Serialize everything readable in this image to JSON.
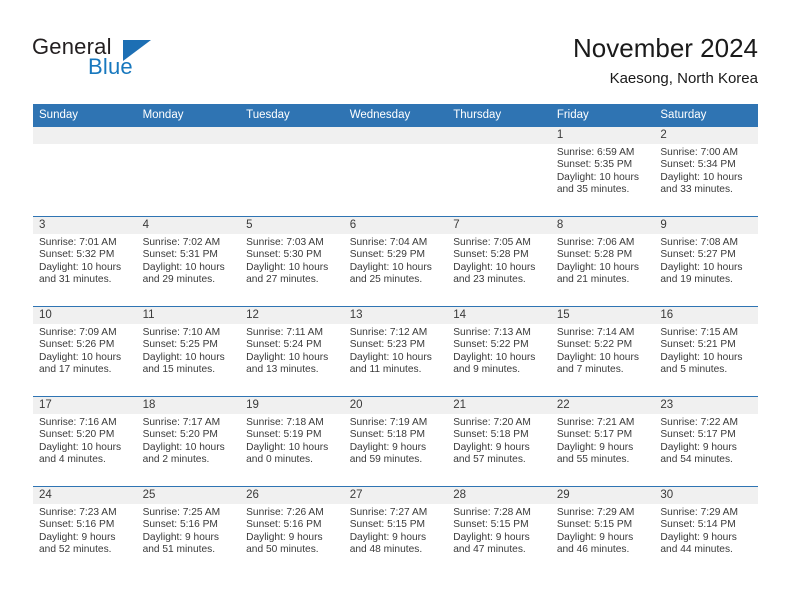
{
  "logo": {
    "word_one": "General",
    "word_two": "Blue",
    "triangle_color": "#1d6fb4",
    "icon": "general-blue-logo"
  },
  "header": {
    "title": "November 2024",
    "subtitle": "Kaesong, North Korea"
  },
  "theme": {
    "header_blue": "#2f74b3",
    "daynum_gray": "#f0f0f0",
    "text": "#3a3a3a"
  },
  "weekday_headers": [
    "Sunday",
    "Monday",
    "Tuesday",
    "Wednesday",
    "Thursday",
    "Friday",
    "Saturday"
  ],
  "labels": {
    "sunrise": "Sunrise:",
    "sunset": "Sunset:",
    "daylight": "Daylight:"
  },
  "weeks": [
    [
      {
        "day": "",
        "blank": true
      },
      {
        "day": "",
        "blank": true
      },
      {
        "day": "",
        "blank": true
      },
      {
        "day": "",
        "blank": true
      },
      {
        "day": "",
        "blank": true
      },
      {
        "day": "1",
        "sunrise": "Sunrise: 6:59 AM",
        "sunset": "Sunset: 5:35 PM",
        "daylight": "Daylight: 10 hours and 35 minutes."
      },
      {
        "day": "2",
        "sunrise": "Sunrise: 7:00 AM",
        "sunset": "Sunset: 5:34 PM",
        "daylight": "Daylight: 10 hours and 33 minutes."
      }
    ],
    [
      {
        "day": "3",
        "sunrise": "Sunrise: 7:01 AM",
        "sunset": "Sunset: 5:32 PM",
        "daylight": "Daylight: 10 hours and 31 minutes."
      },
      {
        "day": "4",
        "sunrise": "Sunrise: 7:02 AM",
        "sunset": "Sunset: 5:31 PM",
        "daylight": "Daylight: 10 hours and 29 minutes."
      },
      {
        "day": "5",
        "sunrise": "Sunrise: 7:03 AM",
        "sunset": "Sunset: 5:30 PM",
        "daylight": "Daylight: 10 hours and 27 minutes."
      },
      {
        "day": "6",
        "sunrise": "Sunrise: 7:04 AM",
        "sunset": "Sunset: 5:29 PM",
        "daylight": "Daylight: 10 hours and 25 minutes."
      },
      {
        "day": "7",
        "sunrise": "Sunrise: 7:05 AM",
        "sunset": "Sunset: 5:28 PM",
        "daylight": "Daylight: 10 hours and 23 minutes."
      },
      {
        "day": "8",
        "sunrise": "Sunrise: 7:06 AM",
        "sunset": "Sunset: 5:28 PM",
        "daylight": "Daylight: 10 hours and 21 minutes."
      },
      {
        "day": "9",
        "sunrise": "Sunrise: 7:08 AM",
        "sunset": "Sunset: 5:27 PM",
        "daylight": "Daylight: 10 hours and 19 minutes."
      }
    ],
    [
      {
        "day": "10",
        "sunrise": "Sunrise: 7:09 AM",
        "sunset": "Sunset: 5:26 PM",
        "daylight": "Daylight: 10 hours and 17 minutes."
      },
      {
        "day": "11",
        "sunrise": "Sunrise: 7:10 AM",
        "sunset": "Sunset: 5:25 PM",
        "daylight": "Daylight: 10 hours and 15 minutes."
      },
      {
        "day": "12",
        "sunrise": "Sunrise: 7:11 AM",
        "sunset": "Sunset: 5:24 PM",
        "daylight": "Daylight: 10 hours and 13 minutes."
      },
      {
        "day": "13",
        "sunrise": "Sunrise: 7:12 AM",
        "sunset": "Sunset: 5:23 PM",
        "daylight": "Daylight: 10 hours and 11 minutes."
      },
      {
        "day": "14",
        "sunrise": "Sunrise: 7:13 AM",
        "sunset": "Sunset: 5:22 PM",
        "daylight": "Daylight: 10 hours and 9 minutes."
      },
      {
        "day": "15",
        "sunrise": "Sunrise: 7:14 AM",
        "sunset": "Sunset: 5:22 PM",
        "daylight": "Daylight: 10 hours and 7 minutes."
      },
      {
        "day": "16",
        "sunrise": "Sunrise: 7:15 AM",
        "sunset": "Sunset: 5:21 PM",
        "daylight": "Daylight: 10 hours and 5 minutes."
      }
    ],
    [
      {
        "day": "17",
        "sunrise": "Sunrise: 7:16 AM",
        "sunset": "Sunset: 5:20 PM",
        "daylight": "Daylight: 10 hours and 4 minutes."
      },
      {
        "day": "18",
        "sunrise": "Sunrise: 7:17 AM",
        "sunset": "Sunset: 5:20 PM",
        "daylight": "Daylight: 10 hours and 2 minutes."
      },
      {
        "day": "19",
        "sunrise": "Sunrise: 7:18 AM",
        "sunset": "Sunset: 5:19 PM",
        "daylight": "Daylight: 10 hours and 0 minutes."
      },
      {
        "day": "20",
        "sunrise": "Sunrise: 7:19 AM",
        "sunset": "Sunset: 5:18 PM",
        "daylight": "Daylight: 9 hours and 59 minutes."
      },
      {
        "day": "21",
        "sunrise": "Sunrise: 7:20 AM",
        "sunset": "Sunset: 5:18 PM",
        "daylight": "Daylight: 9 hours and 57 minutes."
      },
      {
        "day": "22",
        "sunrise": "Sunrise: 7:21 AM",
        "sunset": "Sunset: 5:17 PM",
        "daylight": "Daylight: 9 hours and 55 minutes."
      },
      {
        "day": "23",
        "sunrise": "Sunrise: 7:22 AM",
        "sunset": "Sunset: 5:17 PM",
        "daylight": "Daylight: 9 hours and 54 minutes."
      }
    ],
    [
      {
        "day": "24",
        "sunrise": "Sunrise: 7:23 AM",
        "sunset": "Sunset: 5:16 PM",
        "daylight": "Daylight: 9 hours and 52 minutes."
      },
      {
        "day": "25",
        "sunrise": "Sunrise: 7:25 AM",
        "sunset": "Sunset: 5:16 PM",
        "daylight": "Daylight: 9 hours and 51 minutes."
      },
      {
        "day": "26",
        "sunrise": "Sunrise: 7:26 AM",
        "sunset": "Sunset: 5:16 PM",
        "daylight": "Daylight: 9 hours and 50 minutes."
      },
      {
        "day": "27",
        "sunrise": "Sunrise: 7:27 AM",
        "sunset": "Sunset: 5:15 PM",
        "daylight": "Daylight: 9 hours and 48 minutes."
      },
      {
        "day": "28",
        "sunrise": "Sunrise: 7:28 AM",
        "sunset": "Sunset: 5:15 PM",
        "daylight": "Daylight: 9 hours and 47 minutes."
      },
      {
        "day": "29",
        "sunrise": "Sunrise: 7:29 AM",
        "sunset": "Sunset: 5:15 PM",
        "daylight": "Daylight: 9 hours and 46 minutes."
      },
      {
        "day": "30",
        "sunrise": "Sunrise: 7:29 AM",
        "sunset": "Sunset: 5:14 PM",
        "daylight": "Daylight: 9 hours and 44 minutes."
      }
    ]
  ]
}
